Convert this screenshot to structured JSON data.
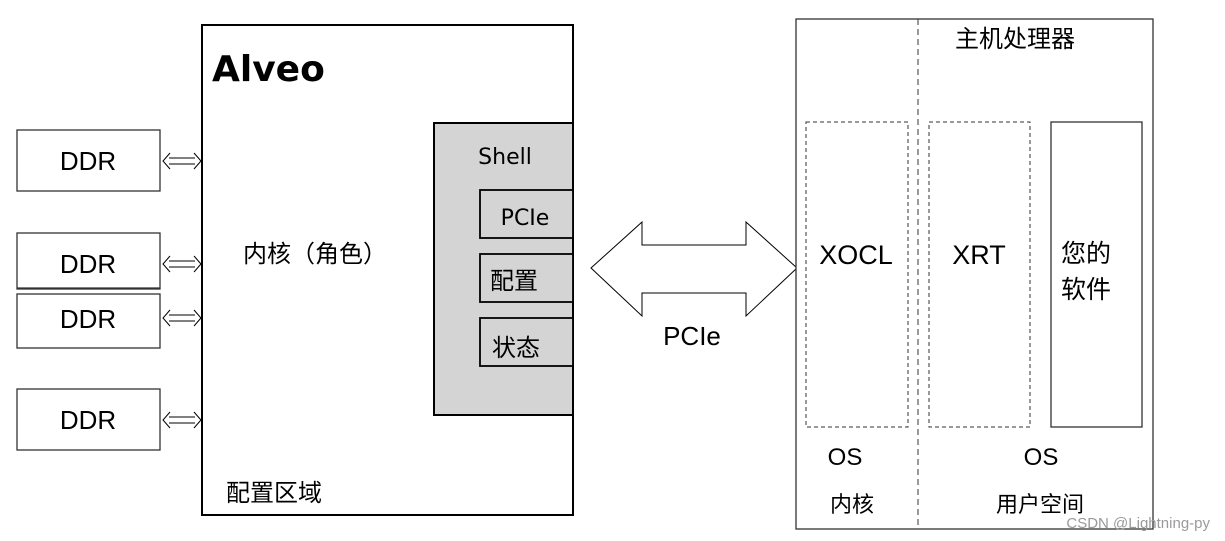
{
  "fpga": {
    "title": "Alveo",
    "kernel_label": "内核（角色）",
    "config_region_label": "配置区域",
    "shell": {
      "label": "Shell",
      "blocks": [
        "PCIe",
        "配置",
        "状态"
      ],
      "fill_color": "#d4d4d4"
    }
  },
  "memory": {
    "ddr": [
      "DDR",
      "DDR",
      "DDR",
      "DDR"
    ]
  },
  "link": {
    "label": "PCIe"
  },
  "host": {
    "title": "主机处理器",
    "xocl": "XOCL",
    "xrt": "XRT",
    "software_line1": "您的",
    "software_line2": "软件",
    "os_kernel": "OS",
    "os_user": "OS",
    "kernel_space": "内核",
    "user_space": "用户空间"
  },
  "watermark": "CSDN @Lightning-py"
}
